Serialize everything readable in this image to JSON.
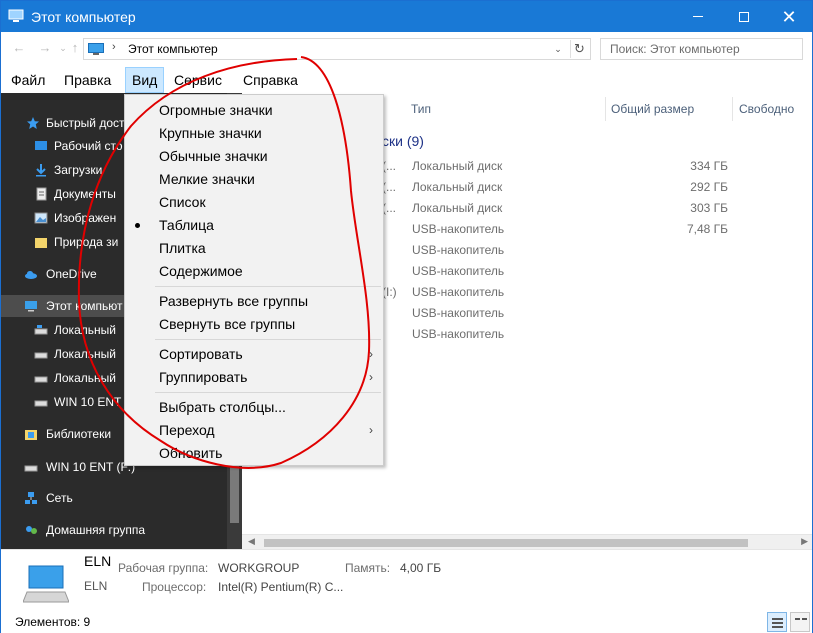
{
  "window": {
    "title": "Этот компьютер",
    "accent_color": "#1979d6",
    "controls": {
      "minimize_icon": "minimize-icon",
      "maximize_icon": "maximize-icon",
      "close_symbol": "✕"
    }
  },
  "address_bar": {
    "back_symbol": "←",
    "forward_symbol": "→",
    "dropdown_symbol": "⌄",
    "up_symbol": "↑",
    "separator": "›",
    "path": "Этот компьютер",
    "dropdown_arrow": "⌄",
    "refresh_symbol": "↻",
    "search_placeholder": "Поиск: Этот компьютер"
  },
  "menubar": {
    "items": [
      {
        "label": "Файл"
      },
      {
        "label": "Правка"
      },
      {
        "label": "Вид",
        "active": true
      },
      {
        "label": "Сервис"
      },
      {
        "label": "Справка"
      }
    ]
  },
  "nav_pane": {
    "items": [
      {
        "label": "Быстрый дост",
        "icon": "star-icon"
      },
      {
        "label": "Рабочий сто",
        "icon": "desktop-icon"
      },
      {
        "label": "Загрузки",
        "icon": "download-icon"
      },
      {
        "label": "Документы",
        "icon": "documents-icon"
      },
      {
        "label": "Изображен",
        "icon": "pictures-icon"
      },
      {
        "label": "Природа зи",
        "icon": "folder-icon"
      },
      {
        "label": "OneDrive",
        "icon": "onedrive-icon"
      },
      {
        "label": "Этот компьют",
        "icon": "computer-icon",
        "selected": true
      },
      {
        "label": "Локальный",
        "icon": "disk-icon"
      },
      {
        "label": "Локальный",
        "icon": "disk-icon"
      },
      {
        "label": "Локальный",
        "icon": "disk-icon"
      },
      {
        "label": "WIN 10 ENT",
        "icon": "usb-drive-icon"
      },
      {
        "label": "Библиотеки",
        "icon": "libraries-icon"
      },
      {
        "label": "WIN 10 ENT (F:)",
        "icon": "usb-drive-icon"
      },
      {
        "label": "Сеть",
        "icon": "network-icon"
      },
      {
        "label": "Домашняя группа",
        "icon": "homegroup-icon"
      }
    ]
  },
  "content": {
    "columns": [
      "Тип",
      "Общий размер",
      "Свободно"
    ],
    "group_header": "ски (9)",
    "rows": [
      {
        "prefix": "(...",
        "type": "Локальный диск",
        "size": "334 ГБ"
      },
      {
        "prefix": "(...",
        "type": "Локальный диск",
        "size": "292 ГБ"
      },
      {
        "prefix": "(...",
        "type": "Локальный диск",
        "size": "303 ГБ"
      },
      {
        "prefix": "",
        "type": "USB-накопитель",
        "size": "7,48 ГБ"
      },
      {
        "prefix": "",
        "type": "USB-накопитель",
        "size": ""
      },
      {
        "prefix": "",
        "type": "USB-накопитель",
        "size": ""
      },
      {
        "prefix": "(I:)",
        "type": "USB-накопитель",
        "size": ""
      },
      {
        "prefix": "",
        "type": "USB-накопитель",
        "size": ""
      },
      {
        "prefix": "",
        "type": "USB-накопитель",
        "size": ""
      }
    ]
  },
  "view_menu": {
    "groups": [
      [
        {
          "label": "Огромные значки"
        },
        {
          "label": "Крупные значки"
        },
        {
          "label": "Обычные значки"
        },
        {
          "label": "Мелкие значки"
        },
        {
          "label": "Список"
        },
        {
          "label": "Таблица",
          "checked": true
        },
        {
          "label": "Плитка"
        },
        {
          "label": "Содержимое"
        }
      ],
      [
        {
          "label": "Развернуть все группы"
        },
        {
          "label": "Свернуть все группы"
        }
      ],
      [
        {
          "label": "Сортировать",
          "submenu": true
        },
        {
          "label": "Группировать",
          "submenu": true
        }
      ],
      [
        {
          "label": "Выбрать столбцы..."
        },
        {
          "label": "Переход",
          "submenu": true
        },
        {
          "label": "Обновить"
        }
      ]
    ],
    "submenu_arrow": "›"
  },
  "details_pane": {
    "computer_name": "ELN",
    "computer_name_2": "ELN",
    "workgroup_label": "Рабочая группа:",
    "workgroup_value": "WORKGROUP",
    "memory_label": "Память:",
    "memory_value": "4,00 ГБ",
    "processor_label": "Процессор:",
    "processor_value": "Intel(R) Pentium(R) C..."
  },
  "status_bar": {
    "items_count": "Элементов: 9"
  },
  "annotation": {
    "color": "#e00000",
    "icon": "hand-drawn-circle"
  }
}
